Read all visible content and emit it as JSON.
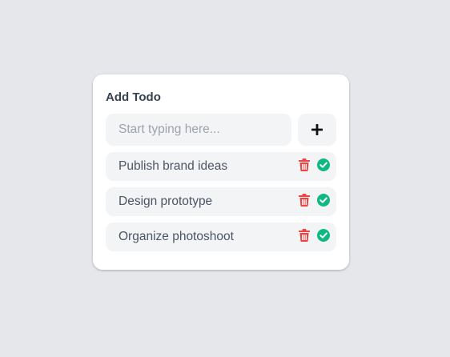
{
  "card": {
    "title": "Add Todo"
  },
  "input": {
    "placeholder": "Start typing here...",
    "value": ""
  },
  "add_button": {
    "icon": "plus-icon"
  },
  "todos": [
    {
      "text": "Publish brand ideas",
      "delete_icon": "trash-icon",
      "complete_icon": "check-circle-icon"
    },
    {
      "text": "Design prototype",
      "delete_icon": "trash-icon",
      "complete_icon": "check-circle-icon"
    },
    {
      "text": "Organize photoshoot",
      "delete_icon": "trash-icon",
      "complete_icon": "check-circle-icon"
    }
  ],
  "colors": {
    "background": "#e5e7eb",
    "card": "#ffffff",
    "field": "#f3f4f6",
    "delete": "#ef4444",
    "complete": "#10b981",
    "text": "#4b5563",
    "title": "#374151"
  }
}
